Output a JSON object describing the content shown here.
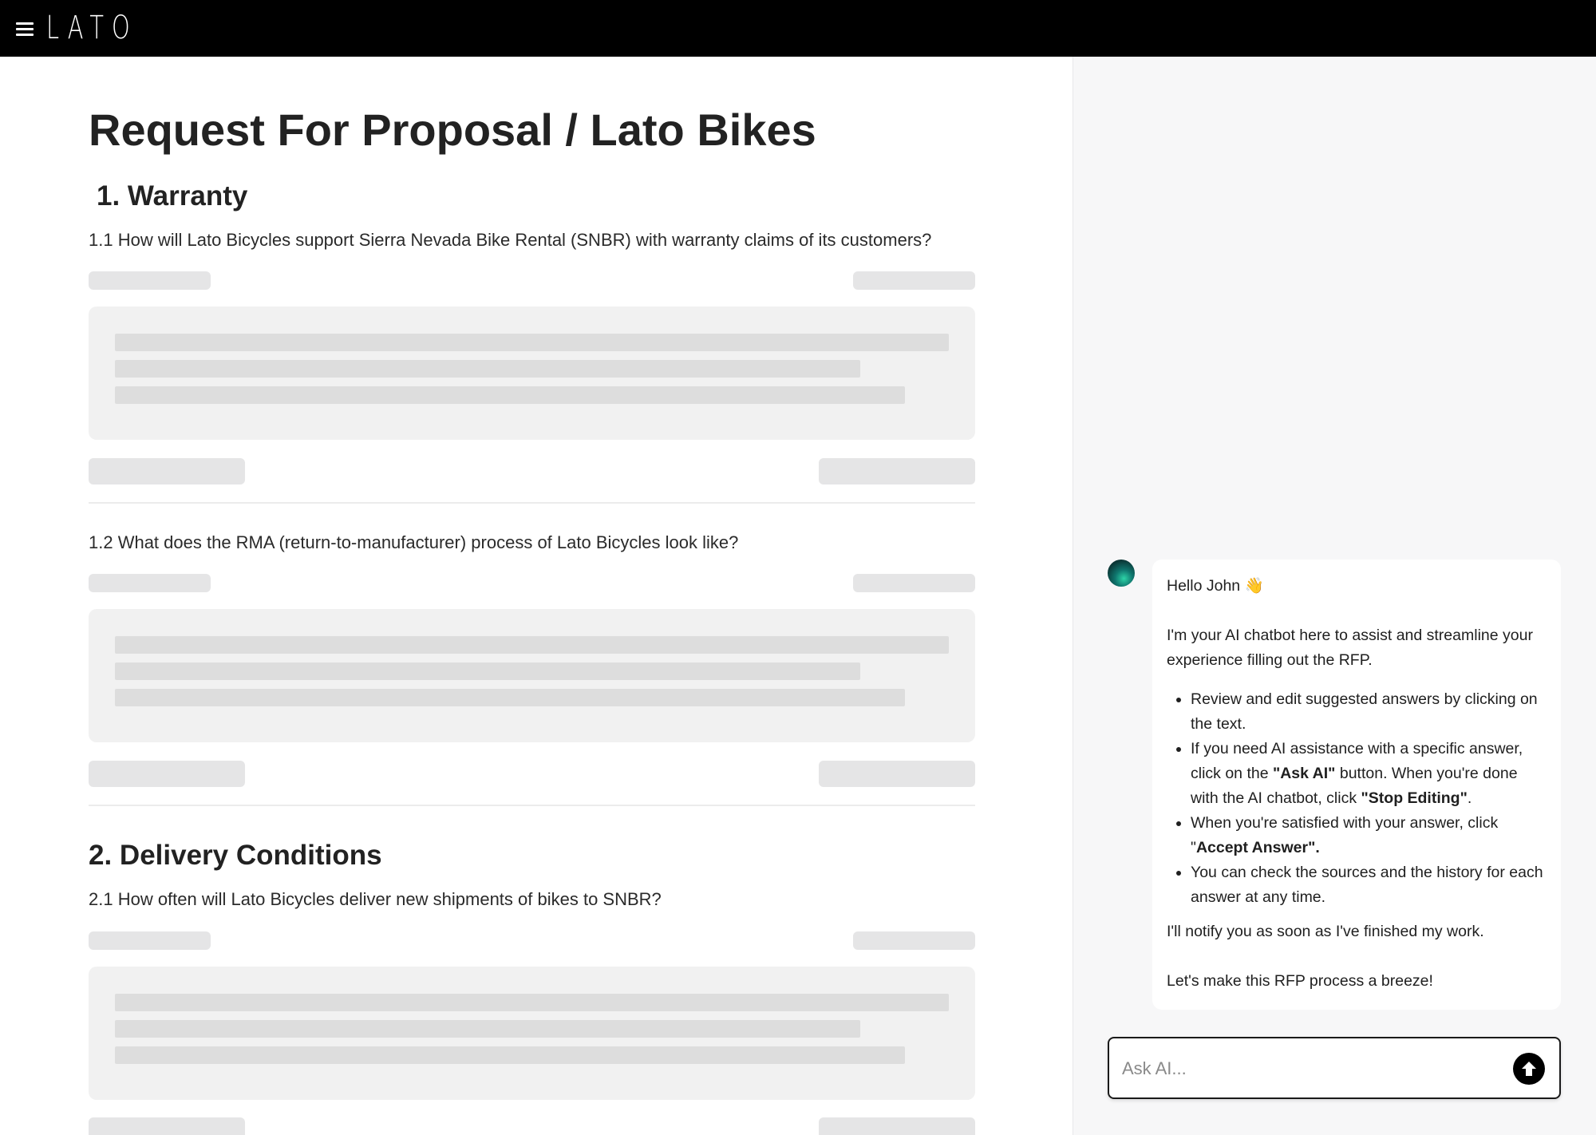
{
  "header": {
    "logo_text": "LATO",
    "menu_icon": "hamburger-menu-icon"
  },
  "document": {
    "title": "Request For Proposal / Lato Bikes",
    "sections": [
      {
        "title": "1. Warranty",
        "questions": [
          "1.1 How will Lato Bicycles support Sierra Nevada Bike Rental (SNBR) with warranty claims of its customers?",
          "1.2 What does the RMA (return-to-manufacturer) process of Lato Bicycles look like?"
        ]
      },
      {
        "title": "2. Delivery Conditions",
        "questions": [
          "2.1 How often will Lato Bicycles deliver new shipments of bikes to SNBR?"
        ]
      }
    ]
  },
  "chat": {
    "greeting": "Hello John 👋",
    "intro": "I'm your AI chatbot here to assist and streamline your experience filling out the RFP.",
    "bullets": [
      {
        "text": "Review and edit suggested answers by clicking on the text."
      },
      {
        "pre": "If you need AI assistance with a specific answer, click on the ",
        "b1": "\"Ask AI\"",
        "mid": " button. When you're done with the AI chatbot, click ",
        "b2": "\"Stop Editing\"",
        "post": "."
      },
      {
        "pre": "When you're satisfied with your answer, click \"",
        "b1": "Accept Answer\"."
      },
      {
        "text": "You can check the sources and the history for each answer at any time."
      }
    ],
    "notify": "I'll notify you as soon as I've finished my work.",
    "closing": "Let's make this RFP process a breeze!",
    "input_placeholder": "Ask AI...",
    "send_icon": "arrow-up-circle-icon"
  }
}
